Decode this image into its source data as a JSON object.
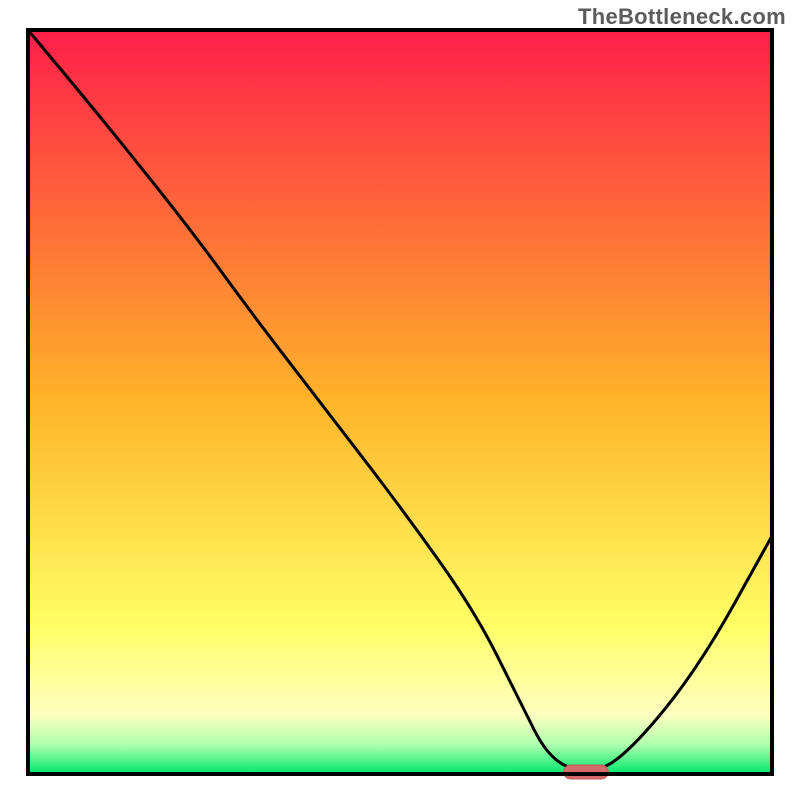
{
  "watermark": "TheBottleneck.com",
  "colors": {
    "frame": "#000000",
    "gradient_stops": [
      {
        "offset": 0.0,
        "color": "#ff1f4a"
      },
      {
        "offset": 0.5,
        "color": "#ffb42a"
      },
      {
        "offset": 0.8,
        "color": "#ffff66"
      },
      {
        "offset": 0.92,
        "color": "#ffffc0"
      },
      {
        "offset": 0.96,
        "color": "#b0ffb0"
      },
      {
        "offset": 1.0,
        "color": "#00e86b"
      }
    ],
    "curve": "#000000",
    "marker_fill": "#d46a6a",
    "marker_stroke": "#c85a5a"
  },
  "chart_data": {
    "type": "line",
    "title": "",
    "xlabel": "",
    "ylabel": "",
    "xlim": [
      0,
      100
    ],
    "ylim": [
      0,
      100
    ],
    "series": [
      {
        "name": "bottleneck-curve",
        "x": [
          0,
          10,
          22,
          30,
          40,
          50,
          60,
          66,
          70,
          75,
          80,
          90,
          100
        ],
        "y": [
          100,
          88,
          73,
          62,
          49,
          36,
          22,
          10,
          2,
          0,
          2,
          14,
          32
        ]
      }
    ],
    "marker": {
      "x": 75,
      "y": 0,
      "width": 6,
      "height": 2
    }
  }
}
